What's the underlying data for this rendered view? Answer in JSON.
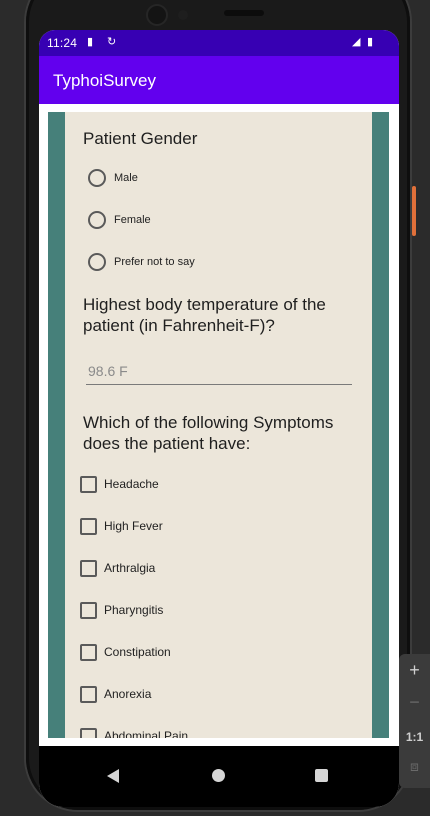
{
  "status_bar": {
    "time": "11:24"
  },
  "app_bar": {
    "title": "TyphoiSurvey"
  },
  "gender_question": {
    "label": "Patient Gender",
    "options": [
      "Male",
      "Female",
      "Prefer not to say"
    ]
  },
  "temperature_question": {
    "label": "Highest body temperature of the patient (in Fahrenheit-F)?",
    "placeholder": "98.6 F"
  },
  "symptoms_question": {
    "label": "Which of the following Symptoms does the patient have:",
    "options": [
      "Headache",
      "High Fever",
      "Arthralgia",
      "Pharyngitis",
      "Constipation",
      "Anorexia",
      "Abdominal Pain"
    ]
  },
  "emulator_toolbar": {
    "zoom_in": "+",
    "zoom_out": "−",
    "actual_size": "1:1"
  },
  "colors": {
    "status_bar": "#3700b3",
    "app_bar": "#6200ee",
    "side_stripe": "#46807a",
    "panel_background": "#ece6da"
  }
}
